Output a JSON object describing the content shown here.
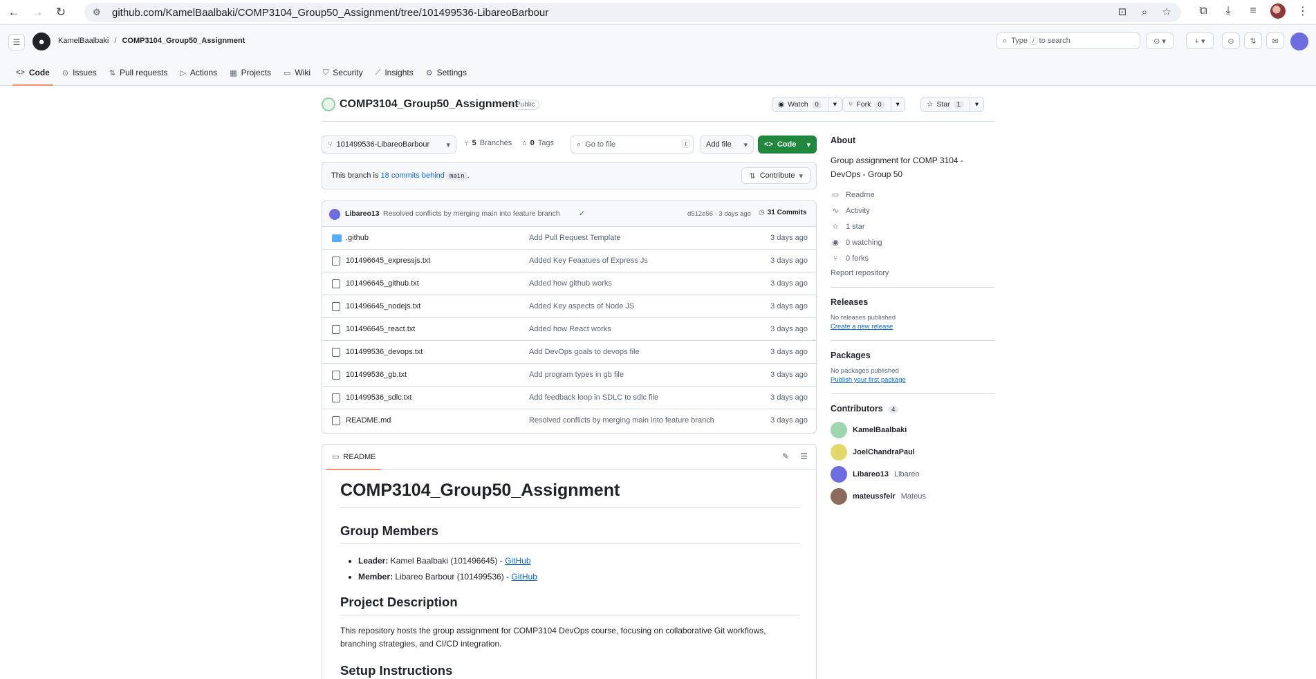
{
  "browser": {
    "url": "github.com/KamelBaalbaki/COMP3104_Group50_Assignment/tree/101499536-LibareoBarbour"
  },
  "header": {
    "owner": "KamelBaalbaki",
    "separator": "/",
    "repo": "COMP3104_Group50_Assignment",
    "search_prefix": "Type",
    "search_key": "/",
    "search_suffix": "to search"
  },
  "tabs": [
    {
      "label": "Code",
      "icon": "code-icon"
    },
    {
      "label": "Issues",
      "icon": "issue-icon"
    },
    {
      "label": "Pull requests",
      "icon": "pull-request-icon"
    },
    {
      "label": "Actions",
      "icon": "play-icon"
    },
    {
      "label": "Projects",
      "icon": "table-icon"
    },
    {
      "label": "Wiki",
      "icon": "book-icon"
    },
    {
      "label": "Security",
      "icon": "shield-icon"
    },
    {
      "label": "Insights",
      "icon": "graph-icon"
    },
    {
      "label": "Settings",
      "icon": "gear-icon"
    }
  ],
  "repo": {
    "name": "COMP3104_Group50_Assignment",
    "visibility": "Public",
    "watch_label": "Watch",
    "watch_count": "0",
    "fork_label": "Fork",
    "fork_count": "0",
    "star_label": "Star",
    "star_count": "1"
  },
  "branch_bar": {
    "branch": "101499536-LibareoBarbour",
    "branches_count": "5",
    "branches_label": "Branches",
    "tags_count": "0",
    "tags_label": "Tags",
    "goto_placeholder": "Go to file",
    "goto_key": "t",
    "add_file": "Add file",
    "code": "Code"
  },
  "behind": {
    "prefix": "This branch is",
    "link": "18 commits behind",
    "base": "main",
    "suffix": ".",
    "contribute": "Contribute"
  },
  "latest_commit": {
    "author": "Libareo13",
    "message": "Resolved conflicts by merging main into feature branch",
    "sha_time": "d512e56 · 3 days ago",
    "commits_label": "31 Commits"
  },
  "files": [
    {
      "name": ".github",
      "type": "folder",
      "message": "Add Pull Request Template",
      "date": "3 days ago"
    },
    {
      "name": "101496645_expressjs.txt",
      "type": "file",
      "message": "Added Key Feaatues of Express Js",
      "date": "3 days ago"
    },
    {
      "name": "101496645_github.txt",
      "type": "file",
      "message": "Added how github works",
      "date": "3 days ago"
    },
    {
      "name": "101496645_nodejs.txt",
      "type": "file",
      "message": "Added Key aspects of Node JS",
      "date": "3 days ago"
    },
    {
      "name": "101496645_react.txt",
      "type": "file",
      "message": "Added how React works",
      "date": "3 days ago"
    },
    {
      "name": "101499536_devops.txt",
      "type": "file",
      "message": "Add DevOps goals to devops file",
      "date": "3 days ago"
    },
    {
      "name": "101499536_gb.txt",
      "type": "file",
      "message": "Add program types in gb file",
      "date": "3 days ago"
    },
    {
      "name": "101499536_sdlc.txt",
      "type": "file",
      "message": "Add feedback loop in SDLC to sdlc file",
      "date": "3 days ago"
    },
    {
      "name": "README.md",
      "type": "file",
      "message": "Resolved conflicts by merging main into feature branch",
      "date": "3 days ago"
    }
  ],
  "readme": {
    "tab": "README",
    "h1": "COMP3104_Group50_Assignment",
    "h2_members": "Group Members",
    "members": [
      {
        "role": "Leader:",
        "text": "Kamel Baalbaki (101496645) -",
        "link": "GitHub"
      },
      {
        "role": "Member:",
        "text": "Libareo Barbour (101499536) -",
        "link": "GitHub"
      }
    ],
    "h2_description": "Project Description",
    "description": "This repository hosts the group assignment for COMP3104 DevOps course, focusing on collaborative Git workflows, branching strategies, and CI/CD integration.",
    "h2_setup": "Setup Instructions"
  },
  "sidebar": {
    "about_title": "About",
    "about_desc": "Group assignment for COMP 3104 - DevOps - Group 50",
    "stats": [
      {
        "icon": "book-icon",
        "glyph": "▭",
        "label": "Readme"
      },
      {
        "icon": "pulse-icon",
        "glyph": "∿",
        "label": "Activity"
      },
      {
        "icon": "star-icon",
        "glyph": "☆",
        "label": "1 star"
      },
      {
        "icon": "eye-icon",
        "glyph": "◉",
        "label": "0 watching"
      },
      {
        "icon": "fork-icon",
        "glyph": "⑂",
        "label": "0 forks"
      }
    ],
    "report": "Report repository",
    "releases_title": "Releases",
    "releases_none": "No releases published",
    "releases_link": "Create a new release",
    "packages_title": "Packages",
    "packages_none": "No packages published",
    "packages_link": "Publish your first package",
    "contributors_title": "Contributors",
    "contributors_count": "4",
    "contributors": [
      {
        "login": "KamelBaalbaki",
        "name": "",
        "color": "#9ed6b0"
      },
      {
        "login": "JoelChandraPaul",
        "name": "",
        "color": "#e3d96a"
      },
      {
        "login": "Libareo13",
        "name": "Libareo",
        "color": "#6d6ce0"
      },
      {
        "login": "mateussfeir",
        "name": "Mateus",
        "color": "#8b6b5a"
      }
    ]
  },
  "colors": {
    "accent": "#0969da",
    "green": "#1f883d",
    "tab_underline": "#fd8c73"
  }
}
